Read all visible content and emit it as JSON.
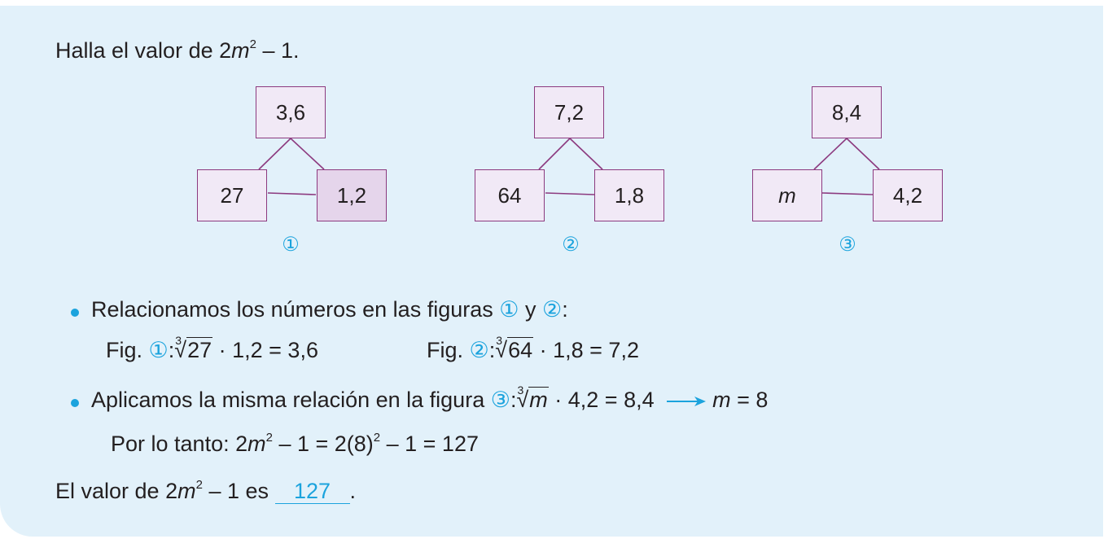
{
  "problem": {
    "prefix": "Halla el valor de ",
    "coef": "2",
    "var": "m",
    "exp": "2",
    "suffix": " – 1."
  },
  "figures": [
    {
      "top": "3,6",
      "left": "27",
      "right": "1,2",
      "label": "①"
    },
    {
      "top": "7,2",
      "left": "64",
      "right": "1,8",
      "label": "②"
    },
    {
      "top": "8,4",
      "left": "m",
      "right": "4,2",
      "label": "③"
    }
  ],
  "step1": {
    "text": "Relacionamos los números en las figuras ",
    "ref1": "①",
    "and": " y ",
    "ref2": "②",
    "colon": ":"
  },
  "step1_formulas": {
    "fig_label": "Fig. ",
    "ref1": "①",
    "index": "3",
    "radicand1": "27",
    "rest1": " · 1,2 = 3,6",
    "ref2": "②",
    "radicand2": "64",
    "rest2": " · 1,8 = 7,2",
    "colon": ":"
  },
  "step2": {
    "text": "Aplicamos la misma relación en la figura ",
    "ref": "③",
    "colon": ":",
    "index": "3",
    "radicand": "m",
    "rest": " · 4,2 = 8,4",
    "result_var": "m",
    "result": " = 8"
  },
  "step3": {
    "text": "Por lo tanto: 2",
    "var": "m",
    "exp": "2",
    "mid": " – 1 = 2(8)",
    "exp2": "2",
    "end": " – 1 = 127"
  },
  "conclusion": {
    "text": "El valor de 2",
    "var": "m",
    "exp": "2",
    "mid": " – 1 es ",
    "answer": "127",
    "end": "."
  },
  "colors": {
    "accent": "#1ba3dd",
    "box_border": "#8c3a7f",
    "box_fill": "#f1e9f6",
    "panel": "#e2f1fa"
  }
}
